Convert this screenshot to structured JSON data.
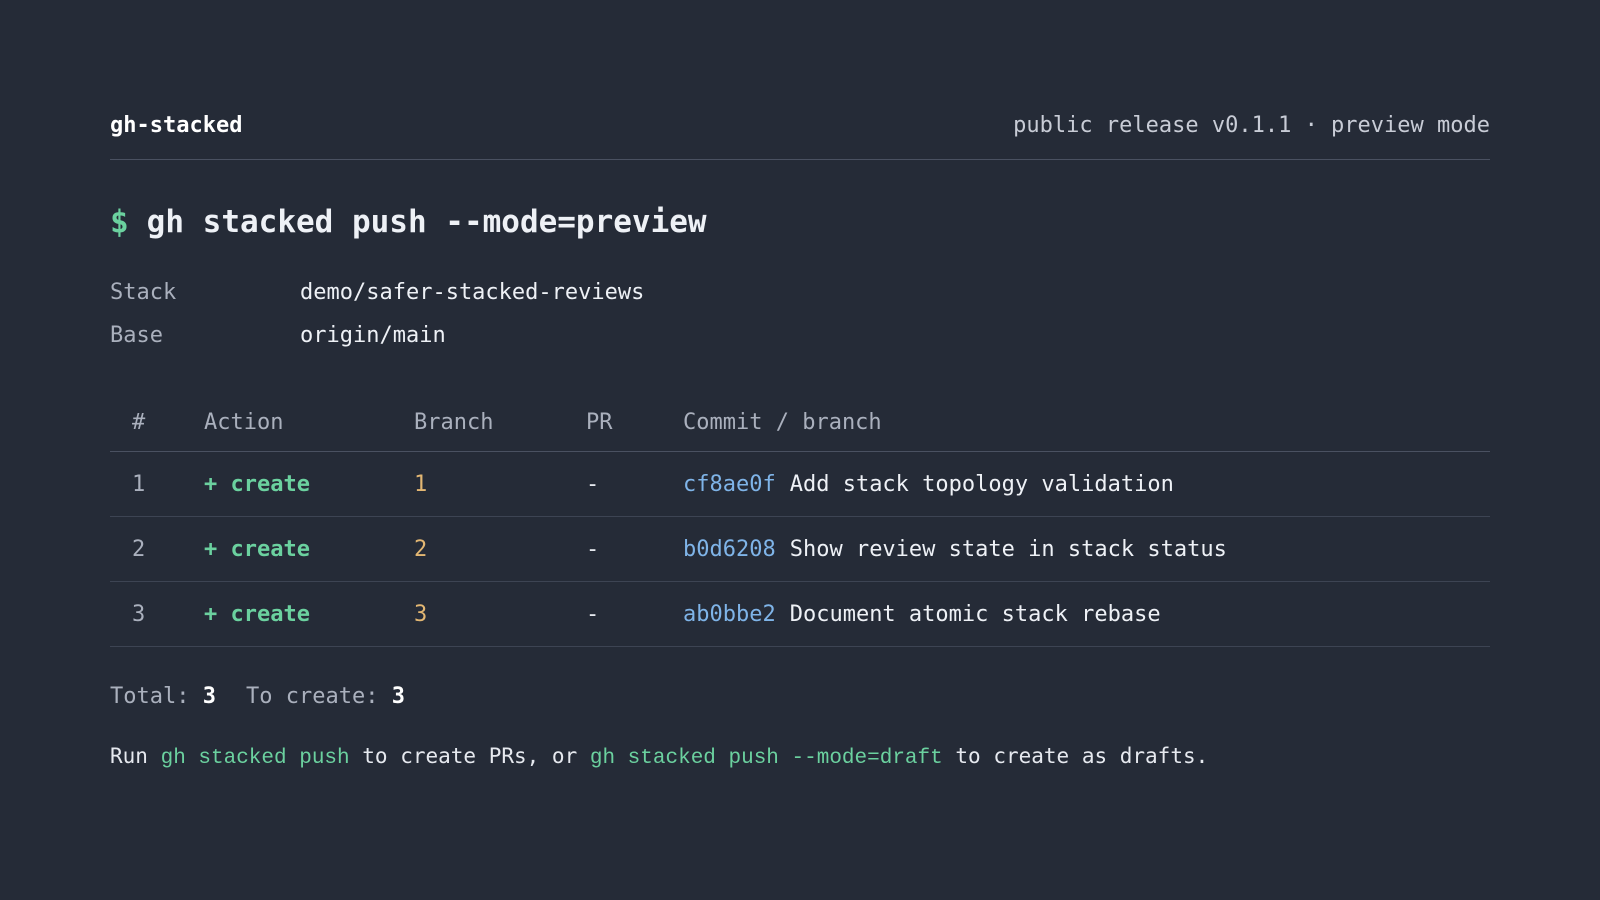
{
  "header": {
    "brand": "gh-stacked",
    "release": "public release v0.1.1 · preview mode"
  },
  "command": {
    "prompt": "$",
    "text": "gh stacked push --mode=preview"
  },
  "meta": [
    {
      "key": "Stack",
      "value": "demo/safer-stacked-reviews"
    },
    {
      "key": "Base",
      "value": "origin/main"
    }
  ],
  "table": {
    "columns": [
      "#",
      "Action",
      "Branch",
      "PR",
      "Commit / branch"
    ],
    "rows": [
      {
        "num": "1",
        "action": "+ create",
        "branch": "1",
        "pr": "-",
        "sha": "cf8ae0f",
        "message": "Add stack topology validation"
      },
      {
        "num": "2",
        "action": "+ create",
        "branch": "2",
        "pr": "-",
        "sha": "b0d6208",
        "message": "Show review state in stack status"
      },
      {
        "num": "3",
        "action": "+ create",
        "branch": "3",
        "pr": "-",
        "sha": "ab0bbe2",
        "message": "Document atomic stack rebase"
      }
    ]
  },
  "totals": {
    "total_label": "Total:",
    "total_value": "3",
    "create_label": "To create:",
    "create_value": "3"
  },
  "hint": {
    "prefix": "Run",
    "cmd1": "gh stacked push",
    "middle": "to create PRs, or",
    "cmd2": "gh stacked push --mode=draft",
    "suffix": "to create as drafts."
  },
  "colors": {
    "background": "#252b37",
    "accent_green": "#6bd19f",
    "branch_yellow": "#e3b773",
    "sha_blue": "#7fb4e8"
  }
}
